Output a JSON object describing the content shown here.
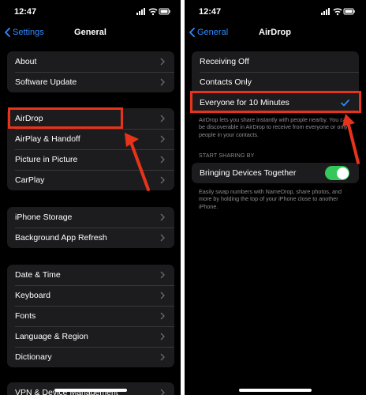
{
  "left": {
    "time": "12:47",
    "back_label": "Settings",
    "title": "General",
    "groups": [
      [
        "About",
        "Software Update"
      ],
      [
        "AirDrop",
        "AirPlay & Handoff",
        "Picture in Picture",
        "CarPlay"
      ],
      [
        "iPhone Storage",
        "Background App Refresh"
      ],
      [
        "Date & Time",
        "Keyboard",
        "Fonts",
        "Language & Region",
        "Dictionary"
      ],
      [
        "VPN & Device Management"
      ]
    ]
  },
  "right": {
    "time": "12:47",
    "back_label": "General",
    "title": "AirDrop",
    "options": [
      "Receiving Off",
      "Contacts Only",
      "Everyone for 10 Minutes"
    ],
    "selected_option": "Everyone for 10 Minutes",
    "description": "AirDrop lets you share instantly with people nearby. You can be discoverable in AirDrop to receive from everyone or only people in your contacts.",
    "start_sharing_header": "START SHARING BY",
    "bringing_devices_label": "Bringing Devices Together",
    "bringing_devices_enabled": true,
    "namedrop_note": "Easily swap numbers with NameDrop, share photos, and more by holding the top of your iPhone close to another iPhone."
  },
  "colors": {
    "accent": "#2f8cff",
    "highlight": "#e8331a",
    "toggle_on": "#34c759",
    "cell_background": "#1c1c1e"
  },
  "icons": [
    "wifi-icon",
    "battery-icon",
    "signal-icon",
    "chevron-left-icon",
    "chevron-right-icon",
    "checkmark-icon",
    "arrow-annotation"
  ]
}
